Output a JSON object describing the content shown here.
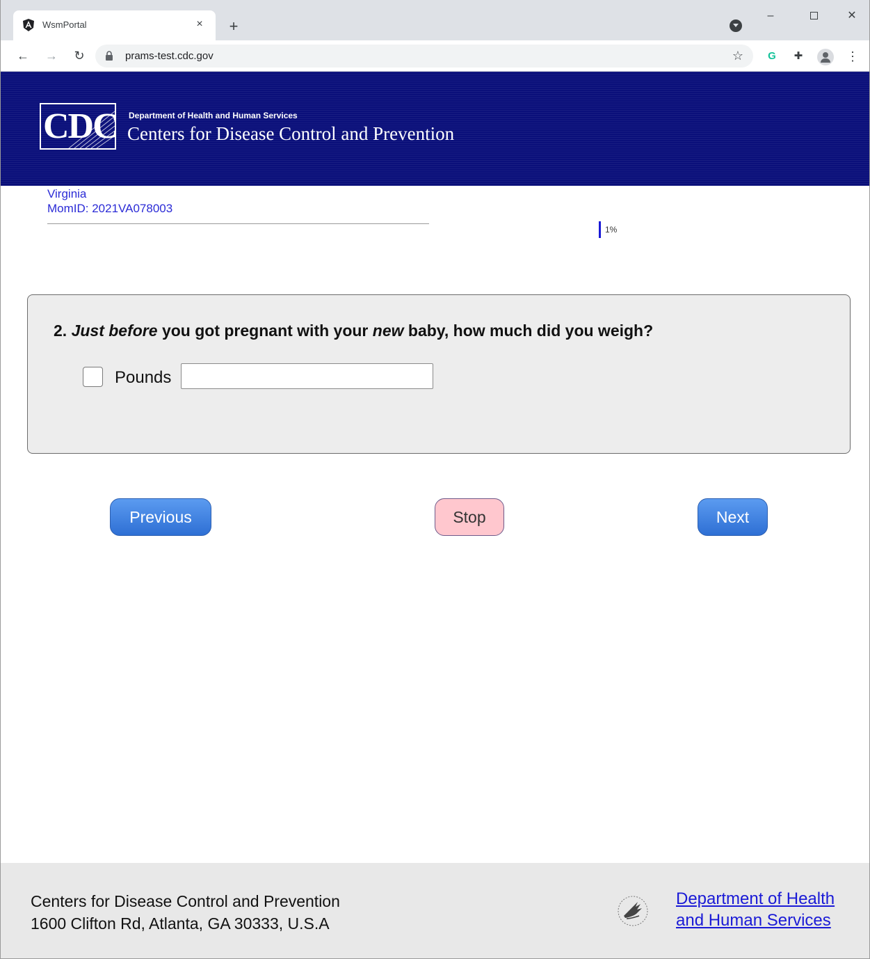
{
  "browser": {
    "tab_title": "WsmPortal",
    "tab_close": "×",
    "new_tab": "+",
    "url": "prams-test.cdc.gov",
    "window_controls": {
      "minimize": "–",
      "close": "✕"
    }
  },
  "header": {
    "logo_text": "CDC",
    "department": "Department of Health and Human Services",
    "agency": "Centers for Disease Control and Prevention"
  },
  "respondent": {
    "state": "Virginia",
    "mom_id": "MomID: 2021VA078003"
  },
  "progress": {
    "percent": 1,
    "label": "1%"
  },
  "question": {
    "number": "2.",
    "text_part1": "Just before",
    "text_part2": " you got pregnant with your ",
    "text_part3": "new",
    "text_part4": " baby, how much did you weigh?",
    "answer_label": "Pounds",
    "answer_value": ""
  },
  "buttons": {
    "previous": "Previous",
    "stop": "Stop",
    "next": "Next"
  },
  "footer": {
    "line1": "Centers for Disease Control and Prevention",
    "line2": "1600 Clifton Rd, Atlanta, GA 30333, U.S.A",
    "hhs_link_line1": "Department of Health",
    "hhs_link_line2": "and Human Services"
  },
  "colors": {
    "header_bg": "#0a0f7a",
    "link_blue": "#1a1ad6",
    "button_blue": "#3a7be0",
    "stop_pink": "#ffc7ce"
  }
}
